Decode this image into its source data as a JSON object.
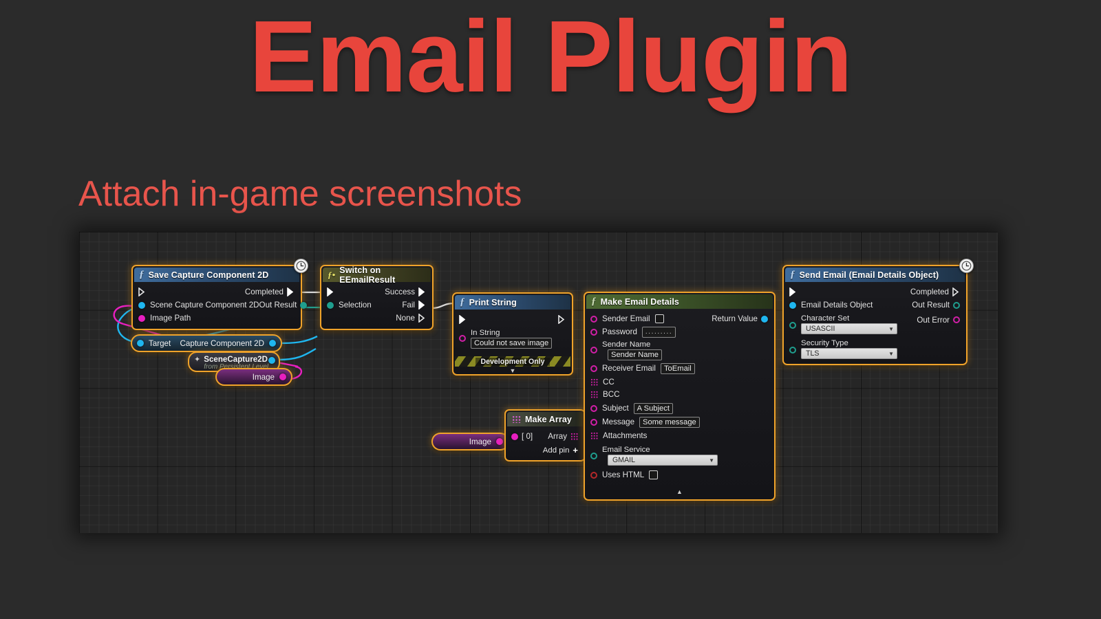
{
  "page": {
    "title": "Email Plugin",
    "subtitle": "Attach in-game screenshots",
    "title_color": "#e8453c",
    "background_color": "#2b2b2b",
    "canvas_background": "#262626",
    "node_border_color": "#f0a32a"
  },
  "nodes": {
    "save_capture": {
      "title": "Save Capture Component 2D",
      "icon": "function-icon",
      "badge": "latent-clock-icon",
      "inputs": [
        {
          "label": "",
          "pin": "exec"
        },
        {
          "label": "Scene Capture Component 2D",
          "pin": "object-cyan"
        },
        {
          "label": "Image Path",
          "pin": "string-magenta"
        }
      ],
      "outputs": [
        {
          "label": "Completed",
          "pin": "exec"
        },
        {
          "label": "Out Result",
          "pin": "enum-teal"
        }
      ]
    },
    "target_knot": {
      "input_label": "Target",
      "output_label": "Capture Component 2D"
    },
    "scene_capture_ref": {
      "title": "SceneCapture2D",
      "subtitle": "from Persistent Level",
      "icon": "component-icon"
    },
    "image_knot_left": {
      "label": "Image"
    },
    "switch_enum": {
      "title": "Switch on EEmailResult",
      "icon": "enum-icon",
      "inputs": [
        {
          "label": "",
          "pin": "exec"
        },
        {
          "label": "Selection",
          "pin": "enum-teal"
        }
      ],
      "outputs": [
        {
          "label": "Success",
          "pin": "exec"
        },
        {
          "label": "Fail",
          "pin": "exec"
        },
        {
          "label": "None",
          "pin": "exec-hollow"
        }
      ]
    },
    "print_string": {
      "title": "Print String",
      "icon": "function-icon",
      "in_string_label": "In String",
      "in_string_value": "Could not save image",
      "dev_banner": "Development Only",
      "inputs": [
        {
          "label": "",
          "pin": "exec"
        }
      ],
      "outputs": [
        {
          "label": "",
          "pin": "exec-hollow"
        }
      ]
    },
    "make_array": {
      "title": "Make Array",
      "icon": "array-icon",
      "element_label": "[ 0]",
      "output_label": "Array",
      "add_pin_label": "Add pin",
      "add_pin_glyph": "+"
    },
    "image_knot_right": {
      "label": "Image"
    },
    "make_email_details": {
      "title": "Make Email Details",
      "icon": "function-icon",
      "return_value_label": "Return Value",
      "fields": [
        {
          "label": "Sender Email",
          "pin": "string-magenta",
          "widget": "checkbox",
          "value": ""
        },
        {
          "label": "Password",
          "pin": "string-magenta",
          "widget": "password",
          "value": "........."
        },
        {
          "label": "Sender Name",
          "pin": "string-magenta",
          "widget": "textfield-below",
          "value": "Sender Name"
        },
        {
          "label": "Receiver Email",
          "pin": "string-magenta",
          "widget": "textfield",
          "value": "ToEmail"
        },
        {
          "label": "CC",
          "pin": "array-magenta",
          "widget": "none",
          "value": ""
        },
        {
          "label": "BCC",
          "pin": "array-magenta",
          "widget": "none",
          "value": ""
        },
        {
          "label": "Subject",
          "pin": "string-magenta",
          "widget": "textfield",
          "value": "A Subject"
        },
        {
          "label": "Message",
          "pin": "string-magenta",
          "widget": "textfield",
          "value": "Some message"
        },
        {
          "label": "Attachments",
          "pin": "array-magenta",
          "widget": "none",
          "value": ""
        },
        {
          "label": "Email Service",
          "pin": "enum-teal",
          "widget": "combo-below",
          "value": "GMAIL"
        },
        {
          "label": "Uses HTML",
          "pin": "bool-red",
          "widget": "checkbox",
          "value": ""
        }
      ],
      "collapse_glyph": "▲"
    },
    "send_email": {
      "title": "Send Email (Email Details Object)",
      "icon": "function-icon",
      "badge": "latent-clock-icon",
      "inputs": [
        {
          "label": "",
          "pin": "exec"
        },
        {
          "label": "Email Details Object",
          "pin": "object-cyan"
        },
        {
          "label": "Character Set",
          "pin": "enum-teal",
          "widget": "combo-below",
          "value": "USASCII"
        },
        {
          "label": "Security Type",
          "pin": "enum-teal",
          "widget": "combo-below",
          "value": "TLS"
        }
      ],
      "outputs": [
        {
          "label": "Completed",
          "pin": "exec-hollow"
        },
        {
          "label": "Out Result",
          "pin": "enum-teal"
        },
        {
          "label": "Out Error",
          "pin": "string-magenta"
        }
      ]
    }
  }
}
